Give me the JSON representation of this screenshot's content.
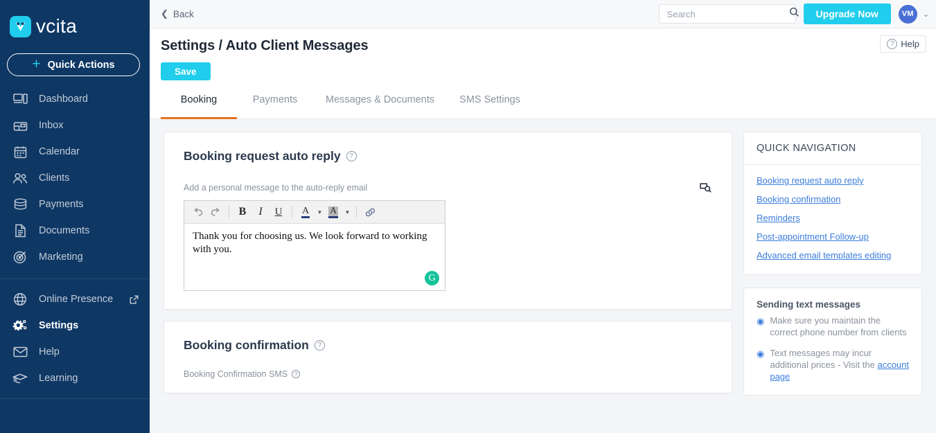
{
  "brand": {
    "name": "vcita",
    "logo_icon": "vcita-logo-icon",
    "accent": "#20cdec",
    "sidebar_bg": "#0e3764",
    "tab_underline": "#e2711d"
  },
  "sidebar": {
    "quick_actions": {
      "label": "Quick Actions",
      "icon": "plus-icon"
    },
    "items": [
      {
        "label": "Dashboard",
        "icon": "dashboard-icon",
        "active": false
      },
      {
        "label": "Inbox",
        "icon": "inbox-icon",
        "active": false
      },
      {
        "label": "Calendar",
        "icon": "calendar-icon",
        "active": false
      },
      {
        "label": "Clients",
        "icon": "clients-icon",
        "active": false
      },
      {
        "label": "Payments",
        "icon": "payments-icon",
        "active": false
      },
      {
        "label": "Documents",
        "icon": "documents-icon",
        "active": false
      },
      {
        "label": "Marketing",
        "icon": "marketing-icon",
        "active": false
      }
    ],
    "items_secondary": [
      {
        "label": "Online Presence",
        "icon": "globe-icon",
        "active": false,
        "external": true
      },
      {
        "label": "Settings",
        "icon": "settings-gears-icon",
        "active": true,
        "external": false
      },
      {
        "label": "Help",
        "icon": "envelope-icon",
        "active": false,
        "external": false
      },
      {
        "label": "Learning",
        "icon": "graduation-cap-icon",
        "active": false,
        "external": false
      }
    ]
  },
  "topbar": {
    "back_label": "Back",
    "back_icon": "chevron-left-icon",
    "search": {
      "value": "",
      "placeholder": "Search",
      "icon": "search-icon"
    },
    "upgrade_label": "Upgrade Now",
    "avatar_initials": "VM",
    "caret_icon": "chevron-down-icon"
  },
  "header": {
    "title": "Settings / Auto Client Messages",
    "save_label": "Save",
    "help_label": "Help",
    "help_icon": "question-circle-icon"
  },
  "tabs": [
    {
      "label": "Booking",
      "active": true
    },
    {
      "label": "Payments",
      "active": false
    },
    {
      "label": "Messages & Documents",
      "active": false
    },
    {
      "label": "SMS Settings",
      "active": false
    }
  ],
  "cards": {
    "auto_reply": {
      "title": "Booking request auto reply",
      "title_help_icon": "question-circle-icon",
      "field_label": "Add a personal message to the auto-reply email",
      "preview_icon": "preview-magnifier-icon",
      "editor": {
        "toolbar": [
          {
            "name": "undo-button",
            "glyph": "↰"
          },
          {
            "name": "redo-button",
            "glyph": "↱"
          },
          {
            "name": "bold-button",
            "glyph": "B"
          },
          {
            "name": "italic-button",
            "glyph": "I"
          },
          {
            "name": "underline-button",
            "glyph": "U"
          },
          {
            "name": "text-color-button",
            "glyph": "A"
          },
          {
            "name": "highlight-color-button",
            "glyph": "A"
          },
          {
            "name": "insert-link-button",
            "glyph": "link-icon"
          }
        ],
        "content": "Thank you for choosing us. We look forward to working with you.",
        "grammarly_badge": "G"
      }
    },
    "booking_confirmation": {
      "title": "Booking confirmation",
      "title_help_icon": "question-circle-icon",
      "field_label": "Booking Confirmation SMS",
      "field_help_icon": "question-circle-icon"
    }
  },
  "quick_navigation": {
    "heading": "QUICK NAVIGATION",
    "links": [
      "Booking request auto reply",
      "Booking confirmation",
      "Reminders",
      "Post-appointment Follow-up",
      "Advanced email templates editing"
    ]
  },
  "tips": {
    "title": "Sending text messages",
    "items": [
      {
        "text": "Make sure you maintain the correct phone number from clients",
        "link": null
      },
      {
        "text": "Text messages may incur additional prices - Visit the ",
        "link": "account page"
      }
    ]
  }
}
